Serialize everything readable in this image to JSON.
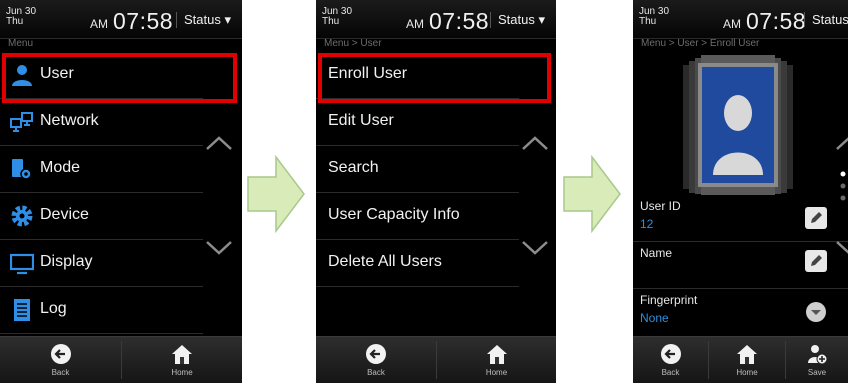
{
  "status_bar": {
    "date_top": "Jun  30",
    "date_bottom": "Thu",
    "ampm": "AM",
    "time": "07:58",
    "status_label": "Status ▾",
    "status_label_short": "Status"
  },
  "screen1": {
    "breadcrumb": "Menu",
    "items": [
      {
        "label": "User",
        "icon": "user-icon"
      },
      {
        "label": "Network",
        "icon": "network-icon"
      },
      {
        "label": "Mode",
        "icon": "mode-icon"
      },
      {
        "label": "Device",
        "icon": "gear-icon"
      },
      {
        "label": "Display",
        "icon": "monitor-icon"
      },
      {
        "label": "Log",
        "icon": "log-icon"
      }
    ]
  },
  "screen2": {
    "breadcrumb": "Menu > User",
    "items": [
      {
        "label": "Enroll User"
      },
      {
        "label": "Edit User"
      },
      {
        "label": "Search"
      },
      {
        "label": "User Capacity Info"
      },
      {
        "label": "Delete All Users"
      }
    ]
  },
  "screen3": {
    "breadcrumb": "Menu > User > Enroll User",
    "fields": [
      {
        "label": "User ID",
        "value": "12",
        "action": "pencil-icon"
      },
      {
        "label": "Name",
        "value": "",
        "action": "pencil-icon"
      },
      {
        "label": "Fingerprint",
        "value": "None",
        "action": "dropdown-icon"
      }
    ]
  },
  "bottom_bar": {
    "back": "Back",
    "home": "Home",
    "save": "Save"
  },
  "colors": {
    "highlight": "#e00000",
    "value_blue": "#2e8fe0",
    "arrow_fill": "#d8ebb8"
  }
}
